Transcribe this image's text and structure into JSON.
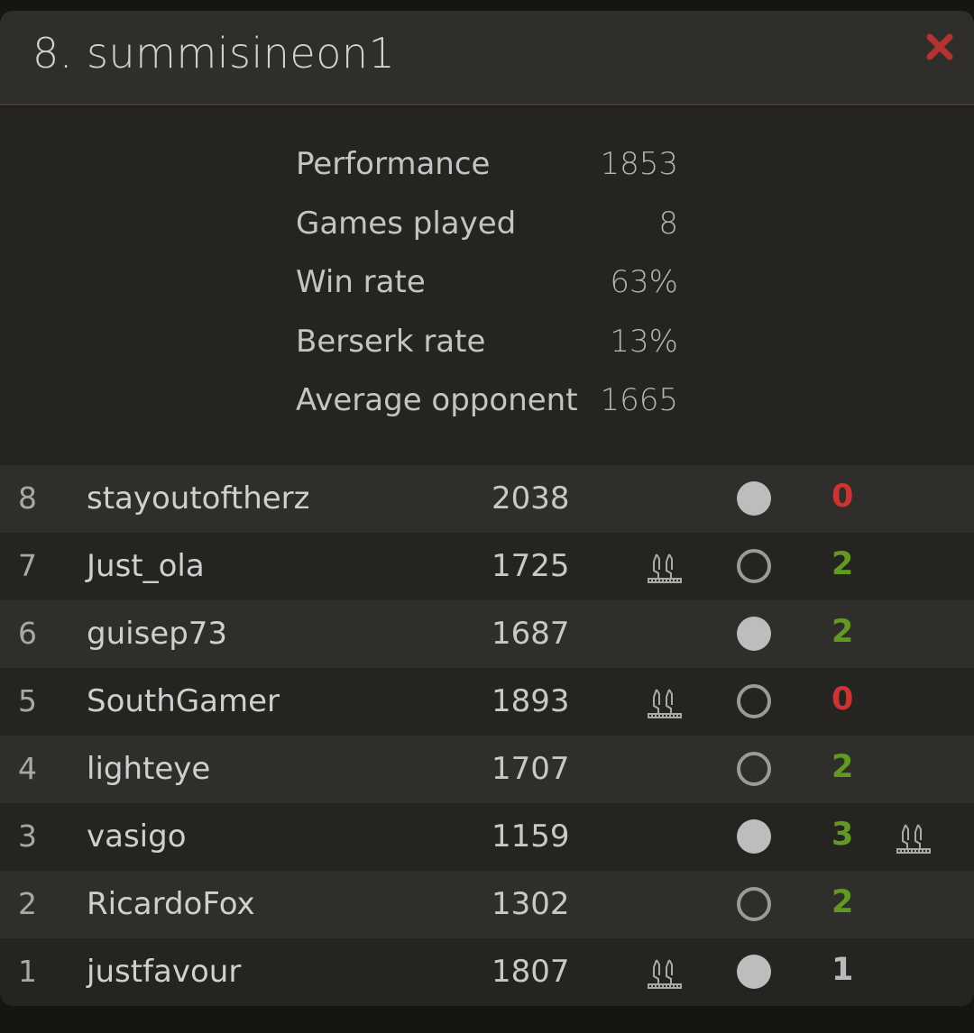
{
  "header": {
    "title": "8. summisineon1"
  },
  "stats": [
    {
      "label": "Performance",
      "value": "1853"
    },
    {
      "label": "Games played",
      "value": "8"
    },
    {
      "label": "Win rate",
      "value": "63%"
    },
    {
      "label": "Berserk rate",
      "value": "13%"
    },
    {
      "label": "Average opponent",
      "value": "1665"
    }
  ],
  "colors": {
    "win": "#629924",
    "loss": "#cc3333",
    "draw": "#bababa",
    "close": "#b23330"
  },
  "games": [
    {
      "num": "8",
      "opponent": "stayoutoftherz",
      "rating": "2038",
      "berserk": false,
      "color": "white",
      "score": "0",
      "result": "loss",
      "opp_berserk": false
    },
    {
      "num": "7",
      "opponent": "Just_ola",
      "rating": "1725",
      "berserk": true,
      "color": "black",
      "score": "2",
      "result": "win",
      "opp_berserk": false
    },
    {
      "num": "6",
      "opponent": "guisep73",
      "rating": "1687",
      "berserk": false,
      "color": "white",
      "score": "2",
      "result": "win",
      "opp_berserk": false
    },
    {
      "num": "5",
      "opponent": "SouthGamer",
      "rating": "1893",
      "berserk": true,
      "color": "black",
      "score": "0",
      "result": "loss",
      "opp_berserk": false
    },
    {
      "num": "4",
      "opponent": "lighteye",
      "rating": "1707",
      "berserk": false,
      "color": "black",
      "score": "2",
      "result": "win",
      "opp_berserk": false
    },
    {
      "num": "3",
      "opponent": "vasigo",
      "rating": "1159",
      "berserk": false,
      "color": "white",
      "score": "3",
      "result": "win",
      "opp_berserk": true
    },
    {
      "num": "2",
      "opponent": "RicardoFox",
      "rating": "1302",
      "berserk": false,
      "color": "black",
      "score": "2",
      "result": "win",
      "opp_berserk": false
    },
    {
      "num": "1",
      "opponent": "justfavour",
      "rating": "1807",
      "berserk": true,
      "color": "white",
      "score": "1",
      "result": "draw",
      "opp_berserk": false
    }
  ],
  "icons": {
    "close": "close-icon",
    "berserk": "berserk-icon"
  }
}
